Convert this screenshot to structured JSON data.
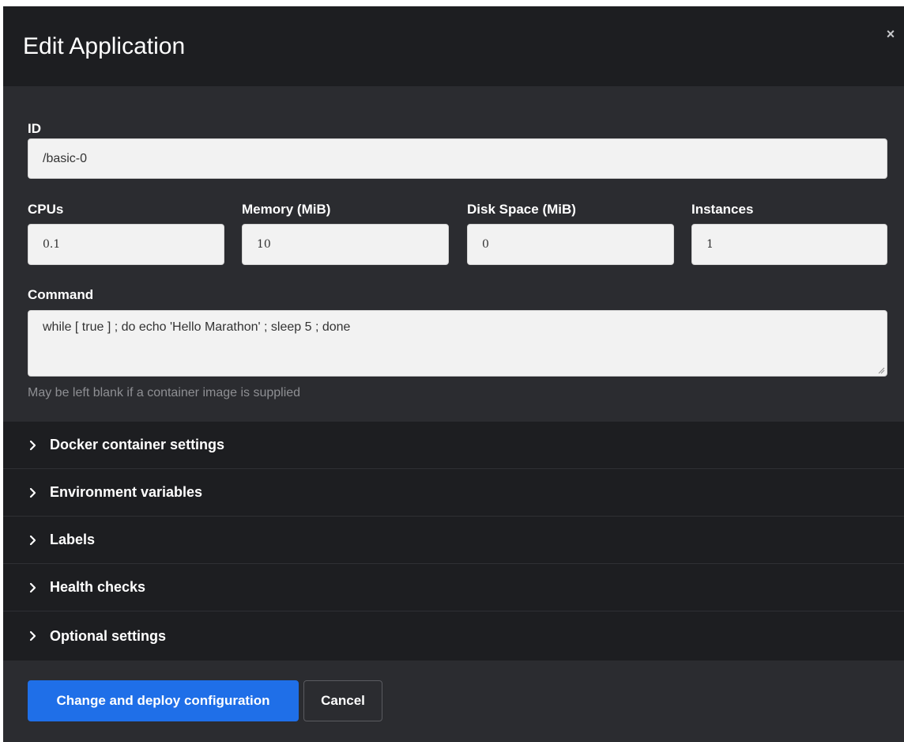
{
  "modal": {
    "title": "Edit Application",
    "close_label": "×"
  },
  "form": {
    "id": {
      "label": "ID",
      "value": "/basic-0"
    },
    "cpus": {
      "label": "CPUs",
      "value": "0.1"
    },
    "memory": {
      "label": "Memory (MiB)",
      "value": "10"
    },
    "disk": {
      "label": "Disk Space (MiB)",
      "value": "0"
    },
    "instances": {
      "label": "Instances",
      "value": "1"
    },
    "command": {
      "label": "Command",
      "value": "while [ true ] ; do echo 'Hello Marathon' ; sleep 5 ; done",
      "help": "May be left blank if a container image is supplied"
    }
  },
  "sections": [
    {
      "label": "Docker container settings"
    },
    {
      "label": "Environment variables"
    },
    {
      "label": "Labels"
    },
    {
      "label": "Health checks"
    },
    {
      "label": "Optional settings"
    }
  ],
  "footer": {
    "submit_label": "Change and deploy configuration",
    "cancel_label": "Cancel"
  },
  "colors": {
    "primary": "#1f6fe8",
    "panel": "#2b2c30",
    "header": "#1d1e21"
  },
  "icons": {
    "close": "close-icon",
    "chevron": "chevron-right-icon"
  }
}
